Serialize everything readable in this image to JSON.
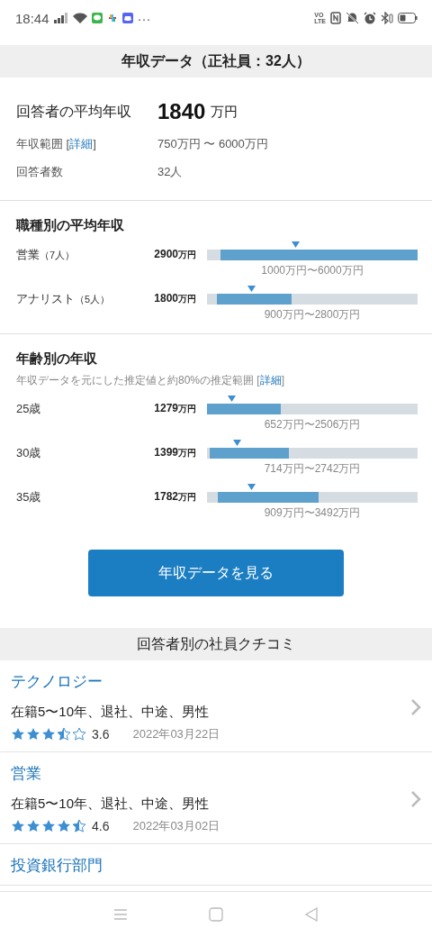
{
  "status_bar": {
    "time": "18:44",
    "more": "···",
    "volte_top": "VO",
    "volte_bottom": "LTE"
  },
  "salary": {
    "title": "年収データ（正社員：32人）",
    "average_label": "回答者の平均年収",
    "average_value": "1840",
    "average_unit": "万円",
    "range_label": "年収範囲 [",
    "range_link": "詳細",
    "range_label_end": "]",
    "range_value": "750万円 〜 6000万円",
    "count_label": "回答者数",
    "count_value": "32人"
  },
  "by_job": {
    "title": "職種別の平均年収",
    "rows": [
      {
        "label": "営業",
        "count": "（7人）",
        "amount": "2900",
        "unit": "万円",
        "range": "1000万円〜6000万円",
        "fill_start": {
          "level": 0.064
        },
        "fill_end": {
          "level": 1
        },
        "marker": {
          "level": 0.42
        }
      },
      {
        "label": "アナリスト",
        "count": "（5人）",
        "amount": "1800",
        "unit": "万円",
        "range": "900万円〜2800万円",
        "fill_start": {
          "level": 0.047
        },
        "fill_end": {
          "level": 0.4
        },
        "marker": {
          "level": 0.21
        }
      }
    ]
  },
  "by_age": {
    "title": "年齢別の年収",
    "note": "年収データを元にした推定値と約80%の推定範囲 [",
    "note_link": "詳細",
    "note_end": "]",
    "rows": [
      {
        "label": "25歳",
        "amount": "1279",
        "unit": "万円",
        "range": "652万円〜2506万円",
        "fill_end": {
          "level": 0.35
        },
        "marker": {
          "level": 0.115
        }
      },
      {
        "label": "30歳",
        "amount": "1399",
        "unit": "万円",
        "range": "714万円〜2742万円",
        "fill_start": {
          "level": 0.013
        },
        "fill_end": {
          "level": 0.39
        },
        "marker": {
          "level": 0.14
        }
      },
      {
        "label": "35歳",
        "amount": "1782",
        "unit": "万円",
        "range": "909万円〜3492万円",
        "fill_start": {
          "level": 0.05
        },
        "fill_end": {
          "level": 0.53
        },
        "marker": {
          "level": 0.21
        }
      }
    ]
  },
  "button": "年収データを見る",
  "reviews": {
    "title": "回答者別の社員クチコミ",
    "items": [
      {
        "job": "テクノロジー",
        "meta": "在籍5〜10年、退社、中途、男性",
        "stars": 3.5,
        "rating": "3.6",
        "date": "2022年03月22日"
      },
      {
        "job": "営業",
        "meta": "在籍5〜10年、退社、中途、男性",
        "stars": 4.5,
        "rating": "4.6",
        "date": "2022年03月02日"
      },
      {
        "job": "投資銀行部門"
      }
    ]
  }
}
